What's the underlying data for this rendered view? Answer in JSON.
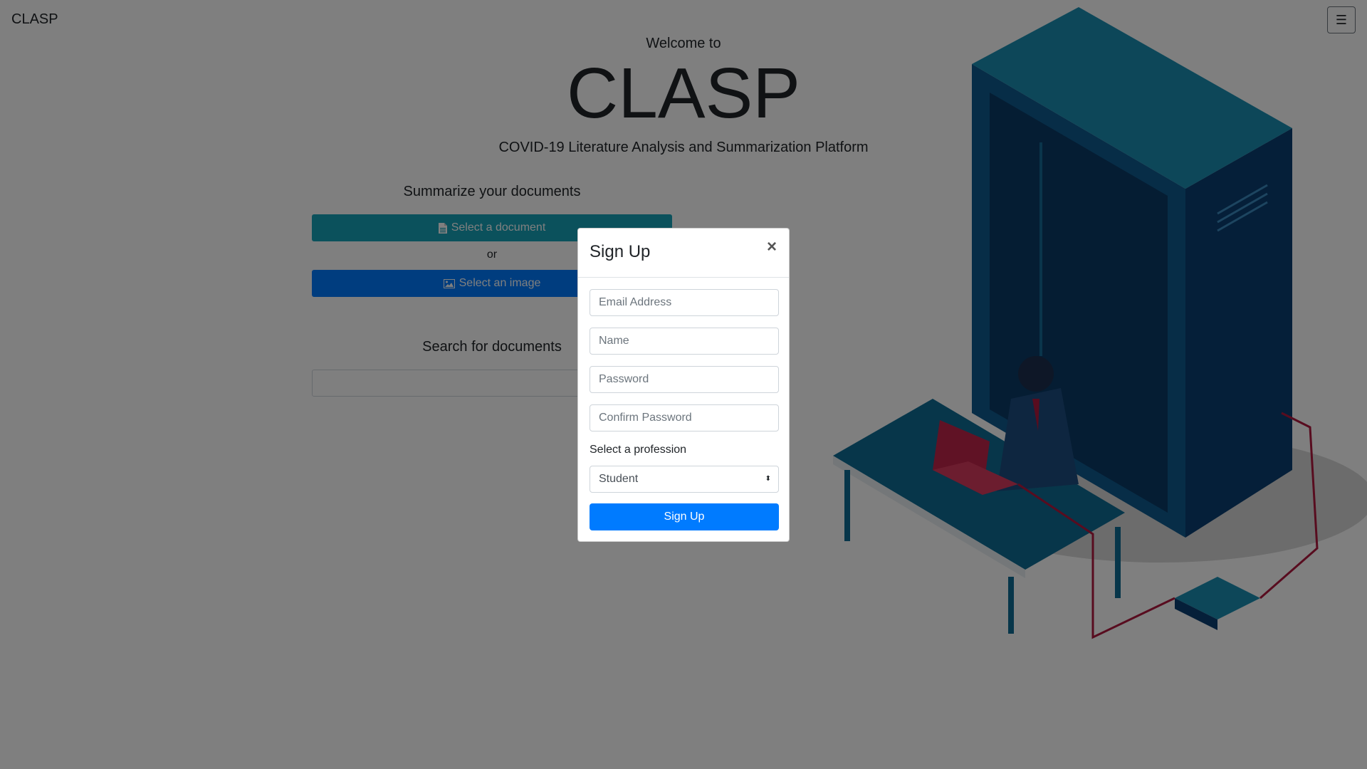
{
  "nav": {
    "brand": "CLASP",
    "menu_icon": "hamburger-icon"
  },
  "hero": {
    "welcome": "Welcome to",
    "title": "CLASP",
    "subtitle": "COVID-19 Literature Analysis and Summarization Platform"
  },
  "summarize": {
    "heading": "Summarize your documents",
    "select_document": "Select a document",
    "select_document_icon": "file-icon",
    "or": "or",
    "select_image": "Select an image",
    "select_image_icon": "image-icon"
  },
  "search": {
    "heading": "Search for documents",
    "value": ""
  },
  "modal": {
    "title": "Sign Up",
    "close": "×",
    "email_placeholder": "Email Address",
    "name_placeholder": "Name",
    "password_placeholder": "Password",
    "confirm_placeholder": "Confirm Password",
    "profession_label": "Select a profession",
    "profession_value": "Student",
    "submit": "Sign Up"
  },
  "colors": {
    "teal": "#17a2b8",
    "blue": "#007bff",
    "backdrop": "rgba(0,0,0,0.5)"
  }
}
